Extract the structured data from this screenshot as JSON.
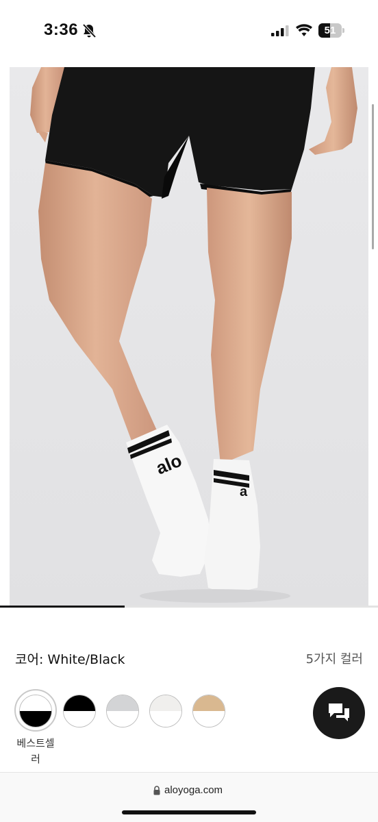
{
  "status_bar": {
    "time": "3:36",
    "battery_level": "51",
    "battery_fraction": 0.51,
    "icons": [
      "bell-slash-icon",
      "cellular-signal-icon",
      "wifi-icon",
      "battery-icon"
    ]
  },
  "product": {
    "image_alt": "Model wearing black shorts and white alo crew socks",
    "sock_logo": "alo",
    "gallery_progress": 0.33,
    "color_label": "코어: White/Black",
    "color_count": "5가지 컬러",
    "swatches": [
      {
        "name": "White/Black",
        "top": "#ffffff",
        "bottom": "#000000",
        "selected": true
      },
      {
        "name": "Black/White",
        "top": "#000000",
        "bottom": "#ffffff",
        "selected": false
      },
      {
        "name": "Grey/White",
        "top": "#d3d4d6",
        "bottom": "#ffffff",
        "selected": false
      },
      {
        "name": "Ivory/White",
        "top": "#f0efed",
        "bottom": "#ffffff",
        "selected": false
      },
      {
        "name": "Tan/White",
        "top": "#d9b890",
        "bottom": "#ffffff",
        "selected": false
      }
    ],
    "bestseller_badge": "베스트셀\n러"
  },
  "chat": {
    "icon": "chat-bubbles-icon",
    "background": "#1a1a1a"
  },
  "browser": {
    "url": "aloyoga.com",
    "icon": "lock-icon"
  }
}
